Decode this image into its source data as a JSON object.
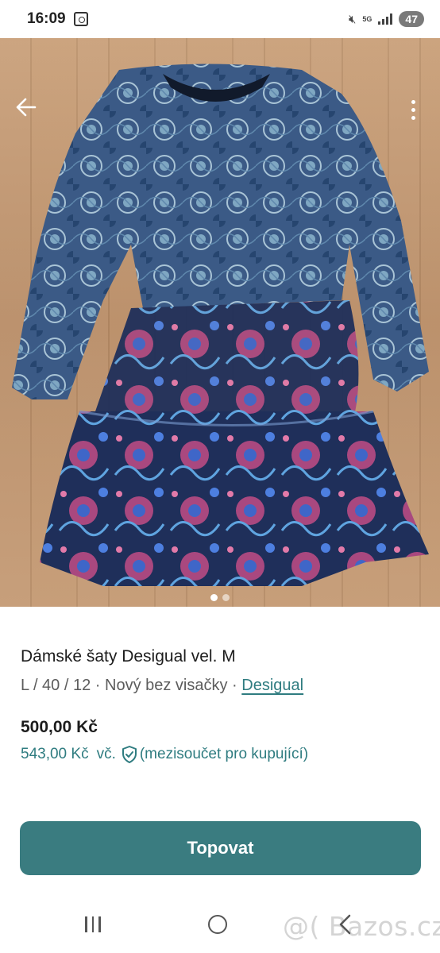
{
  "status_bar": {
    "time": "16:09",
    "network": "5G",
    "battery": "47"
  },
  "listing": {
    "title": "Dámské šaty Desigual vel. M",
    "size_info": "L / 40 / 12",
    "separator": " · ",
    "condition": "Nový bez visačky",
    "brand": "Desigual",
    "price": "500,00 Kč",
    "buyer_price": "543,00 Kč",
    "buyer_price_suffix": "vč.",
    "buyer_price_note": "(mezisoučet pro kupující)"
  },
  "gallery": {
    "image_count": 2,
    "active_index": 0
  },
  "actions": {
    "promote_label": "Topovat"
  },
  "watermark": "@( Bazos.cz",
  "colors": {
    "accent": "#3a7c80",
    "link": "#2f7c80",
    "price_text": "#1d1d1d"
  },
  "icons": [
    "back-arrow-icon",
    "more-vert-icon",
    "shield-check-icon",
    "recent-apps-icon",
    "home-icon",
    "nav-back-icon"
  ]
}
